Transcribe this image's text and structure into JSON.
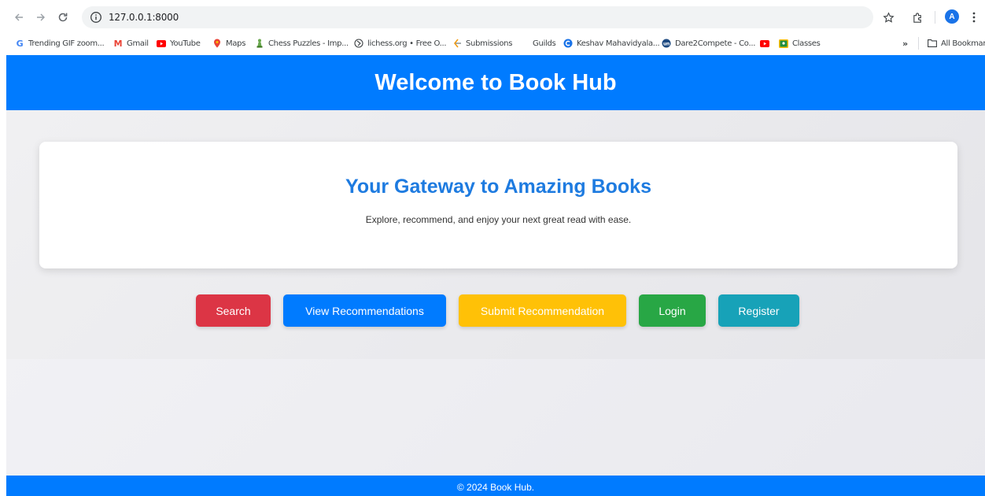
{
  "browser": {
    "url": "127.0.0.1:8000",
    "avatar_letter": "A",
    "bookmarks": [
      {
        "label": "Trending GIF zoom...",
        "icon": "google-icon"
      },
      {
        "label": "Gmail",
        "icon": "gmail-icon"
      },
      {
        "label": "YouTube",
        "icon": "youtube-icon"
      },
      {
        "label": "Maps",
        "icon": "maps-pin-icon"
      },
      {
        "label": "Chess Puzzles - Imp...",
        "icon": "chess-pawn-icon"
      },
      {
        "label": "lichess.org • Free O...",
        "icon": "lichess-icon"
      },
      {
        "label": "Submissions",
        "icon": "submissions-icon"
      },
      {
        "label": "Guilds",
        "icon": ""
      },
      {
        "label": "Keshav Mahavidyala...",
        "icon": "keshav-icon"
      },
      {
        "label": "Dare2Compete - Co...",
        "icon": "unstop-icon"
      },
      {
        "label": "",
        "icon": "youtube-icon"
      },
      {
        "label": "Classes",
        "icon": "classroom-icon"
      }
    ],
    "overflow": "»",
    "all_bookmarks": "All Bookmarks"
  },
  "header": {
    "title": "Welcome to Book Hub"
  },
  "hero": {
    "title": "Your Gateway to Amazing Books",
    "subtitle": "Explore, recommend, and enjoy your next great read with ease."
  },
  "actions": [
    {
      "label": "Search",
      "color": "#dc3545"
    },
    {
      "label": "View Recommendations",
      "color": "#007bff"
    },
    {
      "label": "Submit Recommendation",
      "color": "#ffc107"
    },
    {
      "label": "Login",
      "color": "#28a745"
    },
    {
      "label": "Register",
      "color": "#17a2b8"
    }
  ],
  "footer": {
    "text": "© 2024 Book Hub."
  },
  "colors": {
    "brand": "#007bff",
    "hero_title": "#1e7be0"
  }
}
